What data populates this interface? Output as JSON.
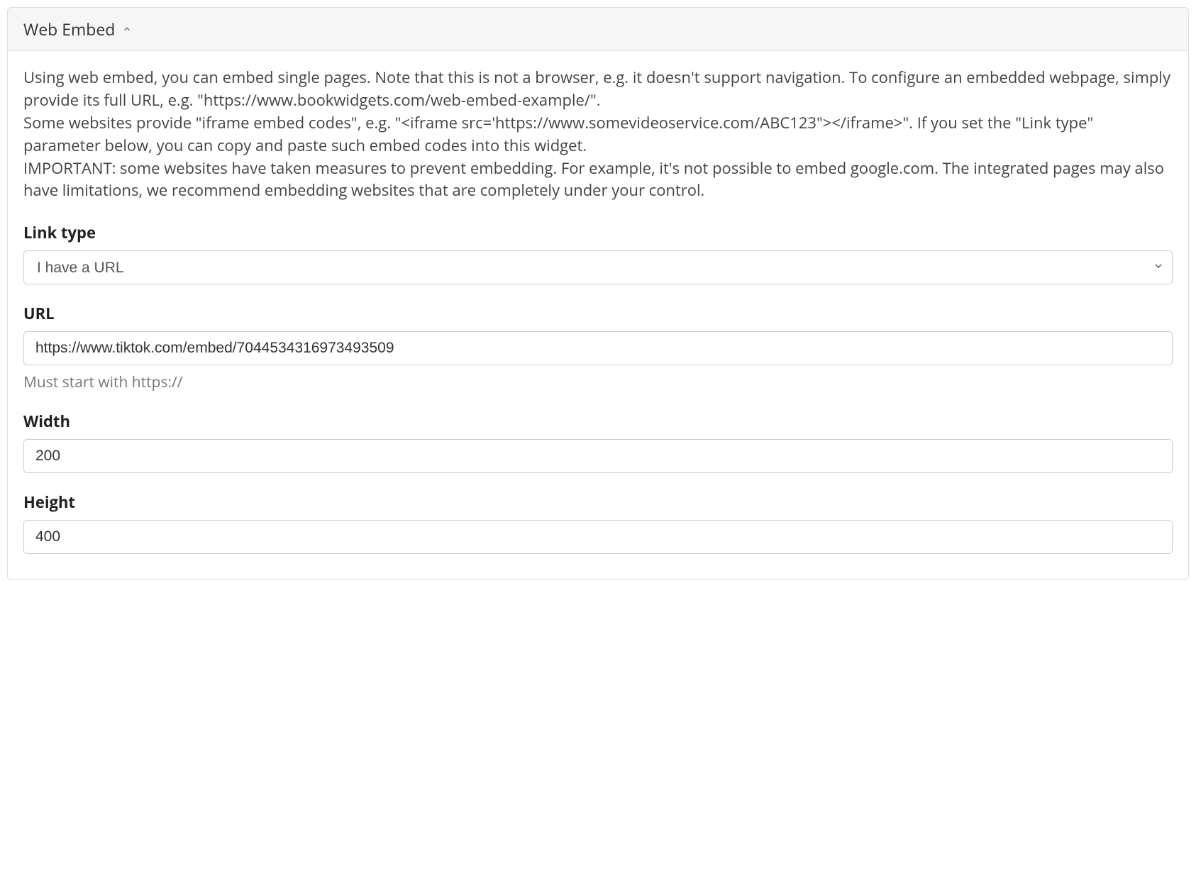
{
  "panel": {
    "title": "Web Embed"
  },
  "description": "Using web embed, you can embed single pages. Note that this is not a browser, e.g. it doesn't support navigation. To configure an embedded webpage, simply provide its full URL, e.g. \"https://www.bookwidgets.com/web-embed-example/\".\nSome websites provide \"iframe embed codes\", e.g. \"<iframe src='https://www.somevideoservice.com/ABC123\"></iframe>\". If you set the \"Link type\" parameter below, you can copy and paste such embed codes into this widget.\nIMPORTANT: some websites have taken measures to prevent embedding. For example, it's not possible to embed google.com. The integrated pages may also have limitations, we recommend embedding websites that are completely under your control.",
  "fields": {
    "linkType": {
      "label": "Link type",
      "value": "I have a URL"
    },
    "url": {
      "label": "URL",
      "value": "https://www.tiktok.com/embed/7044534316973493509",
      "help": "Must start with https://"
    },
    "width": {
      "label": "Width",
      "value": "200"
    },
    "height": {
      "label": "Height",
      "value": "400"
    }
  }
}
